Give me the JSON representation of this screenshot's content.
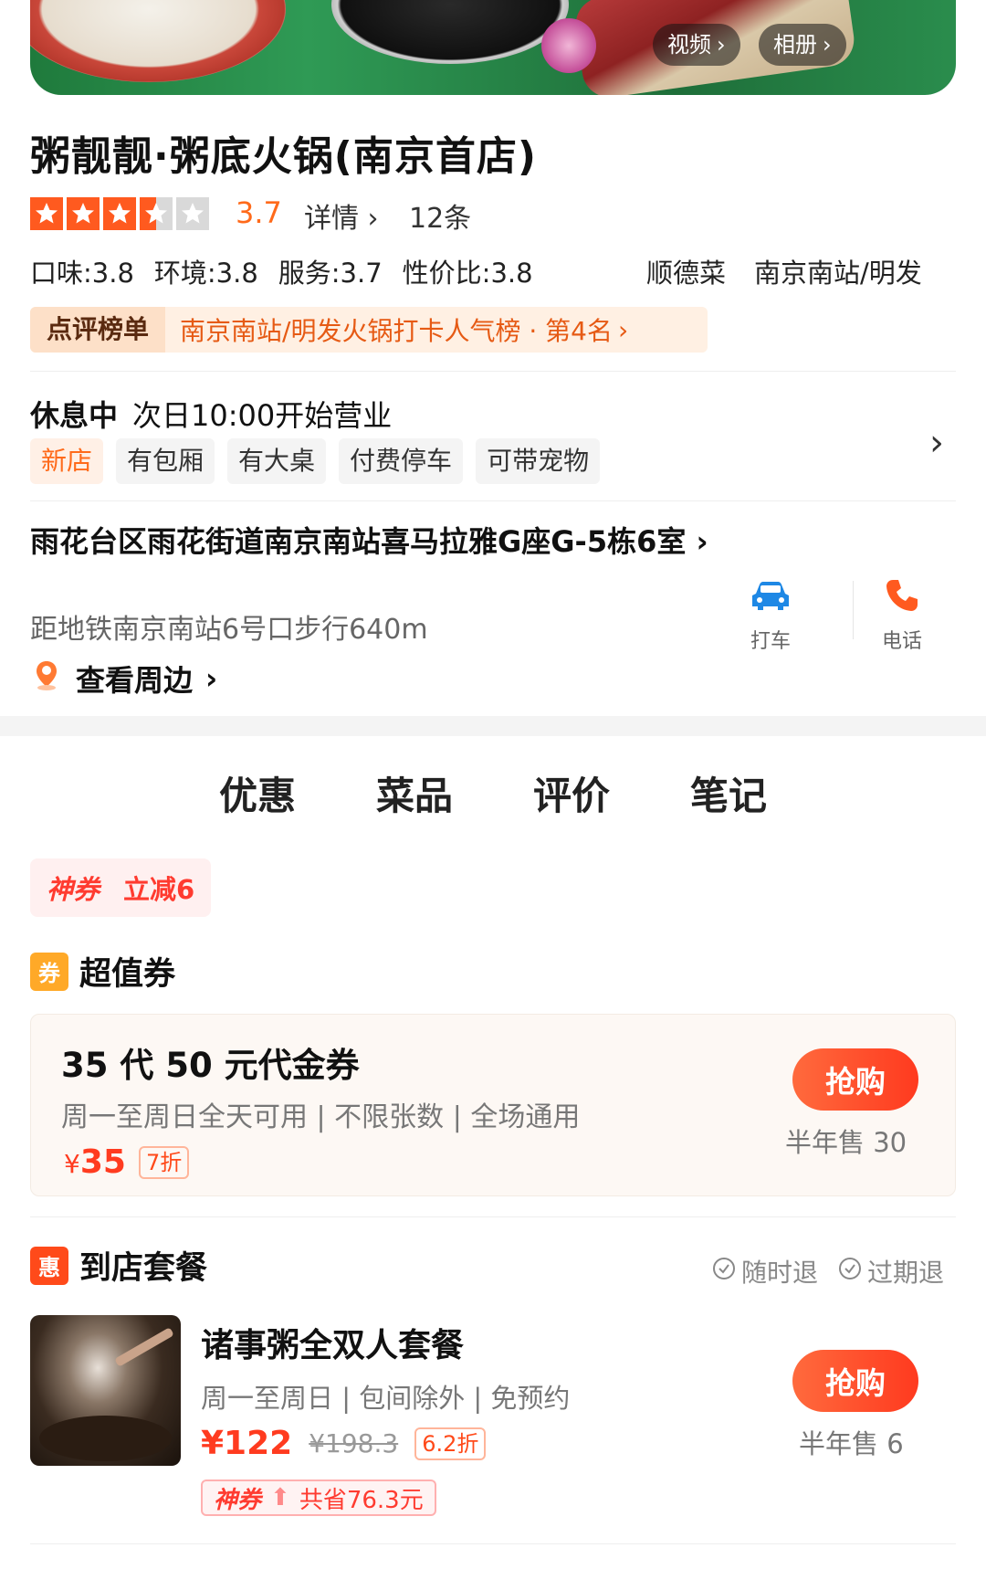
{
  "hero": {
    "video_label": "视频",
    "album_label": "相册"
  },
  "shop": {
    "name": "粥靓靓·粥底火锅(南京首店)",
    "stars": 3.5,
    "rating": "3.7",
    "detail_label": "详情",
    "review_count": "12条",
    "scores": [
      "口味:3.8",
      "环境:3.8",
      "服务:3.7",
      "性价比:3.8"
    ],
    "category": "顺德菜",
    "area": "南京南站/明发"
  },
  "ranking": {
    "tag": "点评榜单",
    "text": "南京南站/明发火锅打卡人气榜 · 第4名"
  },
  "hours": {
    "status": "休息中",
    "next_open": "次日10:00开始营业"
  },
  "tags": [
    "新店",
    "有包厢",
    "有大桌",
    "付费停车",
    "可带宠物"
  ],
  "address": {
    "text": "雨花台区雨花街道南京南站喜马拉雅G座G-5栋6室",
    "metro": "距地铁南京南站6号口步行640m",
    "nearby": "查看周边"
  },
  "actions": {
    "taxi": "打车",
    "phone": "电话"
  },
  "tabs": [
    "优惠",
    "菜品",
    "评价",
    "笔记"
  ],
  "coupon_pill": {
    "label": "神券",
    "text": "立减6"
  },
  "voucher_section": {
    "icon_text": "券",
    "title": "超值券",
    "item": {
      "title": "35 代 50 元代金券",
      "subtitle": "周一至周日全天可用 | 不限张数 | 全场通用",
      "yen": "¥",
      "price": "35",
      "discount": "7折",
      "buy_label": "抢购",
      "sold": "半年售 30"
    }
  },
  "package_section": {
    "icon_text": "惠",
    "title": "到店套餐",
    "badges": [
      "随时退",
      "过期退"
    ],
    "item": {
      "title": "诸事粥全双人套餐",
      "subtitle": "周一至周日 | 包间除外 | 免预约",
      "price": "¥122",
      "old_price": "¥198.3",
      "discount": "6.2折",
      "save_label": "神券",
      "save_text": "共省76.3元",
      "buy_label": "抢购",
      "sold": "半年售 6"
    }
  },
  "colors": {
    "accent": "#ff6a1a",
    "buy": "#ff3a1f",
    "star": "#ff5a1f"
  }
}
